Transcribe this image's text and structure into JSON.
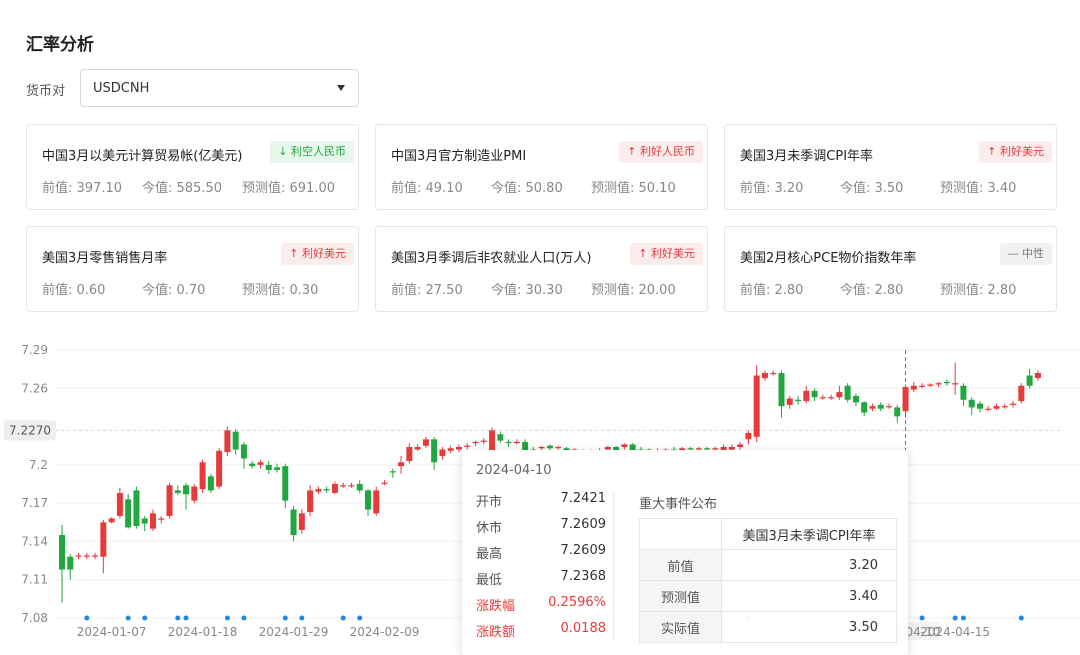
{
  "page": {
    "title": "汇率分析"
  },
  "pair": {
    "label": "货币对",
    "value": "USDCNH"
  },
  "cards": [
    {
      "name": "中国3月以美元计算贸易帐(亿美元)",
      "badge": "利空人民币",
      "badge_icon": "arrow-down-icon",
      "tone": "green",
      "prev": "前值: 397.10",
      "actual": "今值: 585.50",
      "forecast": "预测值: 691.00"
    },
    {
      "name": "中国3月官方制造业PMI",
      "badge": "利好人民币",
      "badge_icon": "arrow-up-icon",
      "tone": "red",
      "prev": "前值: 49.10",
      "actual": "今值: 50.80",
      "forecast": "预测值: 50.10"
    },
    {
      "name": "美国3月未季调CPI年率",
      "badge": "利好美元",
      "badge_icon": "arrow-up-icon",
      "tone": "red",
      "prev": "前值: 3.20",
      "actual": "今值: 3.50",
      "forecast": "预测值: 3.40"
    },
    {
      "name": "美国3月零售销售月率",
      "badge": "利好美元",
      "badge_icon": "arrow-up-icon",
      "tone": "red",
      "prev": "前值: 0.60",
      "actual": "今值: 0.70",
      "forecast": "预测值: 0.30"
    },
    {
      "name": "美国3月季调后非农就业人口(万人)",
      "badge": "利好美元",
      "badge_icon": "arrow-up-icon",
      "tone": "red",
      "prev": "前值: 27.50",
      "actual": "今值: 30.30",
      "forecast": "预测值: 20.00"
    },
    {
      "name": "美国2月核心PCE物价指数年率",
      "badge": "中性",
      "badge_icon": "dash-icon",
      "tone": "gray",
      "prev": "前值: 2.80",
      "actual": "今值: 2.80",
      "forecast": "预测值: 2.80"
    }
  ],
  "colors": {
    "up": "#e63b3b",
    "down": "#22a63f",
    "event_dot": "#1e88e5",
    "crosshair": "#1e88e5",
    "neutral": "#777777"
  },
  "chart_data": {
    "type": "candlestick",
    "y_ticks": [
      "7.29",
      "7.26",
      "7.2",
      "7.17",
      "7.14",
      "7.11",
      "7.08"
    ],
    "ylim": [
      7.08,
      7.29
    ],
    "reference_value": 7.227,
    "reference_label": "7.2270",
    "x_tick_labels": [
      "2024-01-07",
      "2024-01-18",
      "2024-01-29",
      "2024-02-09",
      "2024-04-10",
      "2024-04-15"
    ],
    "x_tick_index": [
      6,
      17,
      28,
      39,
      102,
      108
    ],
    "highlight_index": 102,
    "event_indices": [
      3,
      8,
      10,
      14,
      15,
      20,
      22,
      27,
      29,
      34,
      36,
      83,
      102,
      104,
      108,
      109,
      116
    ],
    "candles": [
      [
        7.145,
        7.118,
        7.153,
        7.092
      ],
      [
        7.128,
        7.118,
        7.13,
        7.11
      ],
      [
        7.129,
        7.129,
        7.131,
        7.126
      ],
      [
        7.129,
        7.129,
        7.131,
        7.126
      ],
      [
        7.129,
        7.129,
        7.131,
        7.126
      ],
      [
        7.128,
        7.155,
        7.157,
        7.115
      ],
      [
        7.155,
        7.158,
        7.159,
        7.154
      ],
      [
        7.16,
        7.178,
        7.182,
        7.158
      ],
      [
        7.173,
        7.151,
        7.177,
        7.15
      ],
      [
        7.18,
        7.152,
        7.183,
        7.15
      ],
      [
        7.158,
        7.154,
        7.16,
        7.148
      ],
      [
        7.15,
        7.162,
        7.165,
        7.148
      ],
      [
        7.157,
        7.158,
        7.16,
        7.154
      ],
      [
        7.16,
        7.184,
        7.186,
        7.158
      ],
      [
        7.18,
        7.178,
        7.184,
        7.176
      ],
      [
        7.184,
        7.177,
        7.186,
        7.165
      ],
      [
        7.172,
        7.183,
        7.185,
        7.17
      ],
      [
        7.181,
        7.202,
        7.204,
        7.178
      ],
      [
        7.191,
        7.18,
        7.193,
        7.178
      ],
      [
        7.183,
        7.211,
        7.213,
        7.181
      ],
      [
        7.21,
        7.227,
        7.23,
        7.207
      ],
      [
        7.226,
        7.212,
        7.228,
        7.208
      ],
      [
        7.216,
        7.205,
        7.218,
        7.197
      ],
      [
        7.201,
        7.199,
        7.203,
        7.197
      ],
      [
        7.2,
        7.202,
        7.204,
        7.197
      ],
      [
        7.2,
        7.196,
        7.203,
        7.193
      ],
      [
        7.198,
        7.196,
        7.201,
        7.194
      ],
      [
        7.199,
        7.172,
        7.201,
        7.166
      ],
      [
        7.165,
        7.145,
        7.168,
        7.14
      ],
      [
        7.149,
        7.162,
        7.165,
        7.146
      ],
      [
        7.163,
        7.18,
        7.184,
        7.16
      ],
      [
        7.179,
        7.181,
        7.183,
        7.177
      ],
      [
        7.181,
        7.18,
        7.183,
        7.178
      ],
      [
        7.178,
        7.185,
        7.187,
        7.177
      ],
      [
        7.183,
        7.184,
        7.186,
        7.182
      ],
      [
        7.184,
        7.184,
        7.186,
        7.182
      ],
      [
        7.185,
        7.18,
        7.188,
        7.178
      ],
      [
        7.18,
        7.165,
        7.181,
        7.16
      ],
      [
        7.162,
        7.18,
        7.183,
        7.16
      ],
      [
        7.186,
        7.186,
        7.188,
        7.184
      ],
      [
        7.195,
        7.194,
        7.197,
        7.19
      ],
      [
        7.199,
        7.202,
        7.207,
        7.193
      ],
      [
        7.203,
        7.214,
        7.217,
        7.201
      ],
      [
        7.212,
        7.214,
        7.216,
        7.211
      ],
      [
        7.215,
        7.22,
        7.222,
        7.213
      ],
      [
        7.22,
        7.202,
        7.222,
        7.196
      ],
      [
        7.207,
        7.212,
        7.214,
        7.204
      ],
      [
        7.211,
        7.213,
        7.215,
        7.209
      ],
      [
        7.212,
        7.214,
        7.216,
        7.21
      ],
      [
        7.214,
        7.215,
        7.217,
        7.212
      ],
      [
        7.217,
        7.218,
        7.219,
        7.215
      ],
      [
        7.218,
        7.219,
        7.221,
        7.216
      ],
      [
        7.21,
        7.227,
        7.229,
        7.207
      ],
      [
        7.224,
        7.219,
        7.226,
        7.217
      ],
      [
        7.218,
        7.217,
        7.22,
        7.214
      ],
      [
        7.218,
        7.218,
        7.22,
        7.216
      ],
      [
        7.218,
        7.209,
        7.22,
        7.204
      ],
      [
        7.212,
        7.211,
        7.214,
        7.209
      ],
      [
        7.213,
        7.214,
        7.215,
        7.211
      ],
      [
        7.215,
        7.213,
        7.216,
        7.211
      ],
      [
        7.214,
        7.214,
        7.215,
        7.212
      ],
      [
        7.213,
        7.209,
        7.214,
        7.206
      ],
      [
        7.212,
        7.212,
        7.213,
        7.21
      ],
      [
        7.211,
        7.211,
        7.212,
        7.21
      ],
      [
        7.211,
        7.209,
        7.212,
        7.207
      ],
      [
        7.209,
        7.211,
        7.213,
        7.207
      ],
      [
        7.212,
        7.214,
        7.215,
        7.21
      ],
      [
        7.214,
        7.211,
        7.215,
        7.209
      ],
      [
        7.214,
        7.216,
        7.217,
        7.212
      ],
      [
        7.216,
        7.21,
        7.217,
        7.208
      ],
      [
        7.212,
        7.211,
        7.214,
        7.209
      ],
      [
        7.212,
        7.21,
        7.213,
        7.208
      ],
      [
        7.21,
        7.211,
        7.213,
        7.208
      ],
      [
        7.212,
        7.212,
        7.213,
        7.21
      ],
      [
        7.212,
        7.211,
        7.214,
        7.209
      ],
      [
        7.211,
        7.213,
        7.214,
        7.21
      ],
      [
        7.213,
        7.212,
        7.214,
        7.211
      ],
      [
        7.212,
        7.213,
        7.214,
        7.211
      ],
      [
        7.213,
        7.212,
        7.214,
        7.211
      ],
      [
        7.212,
        7.213,
        7.214,
        7.211
      ],
      [
        7.21,
        7.214,
        7.216,
        7.208
      ],
      [
        7.212,
        7.214,
        7.216,
        7.21
      ],
      [
        7.214,
        7.216,
        7.218,
        7.212
      ],
      [
        7.22,
        7.225,
        7.227,
        7.216
      ],
      [
        7.222,
        7.27,
        7.278,
        7.218
      ],
      [
        7.268,
        7.272,
        7.274,
        7.266
      ],
      [
        7.272,
        7.272,
        7.274,
        7.27
      ],
      [
        7.272,
        7.246,
        7.274,
        7.237
      ],
      [
        7.247,
        7.252,
        7.254,
        7.244
      ],
      [
        7.251,
        7.25,
        7.254,
        7.247
      ],
      [
        7.25,
        7.258,
        7.262,
        7.248
      ],
      [
        7.258,
        7.253,
        7.26,
        7.25
      ],
      [
        7.253,
        7.253,
        7.255,
        7.251
      ],
      [
        7.253,
        7.253,
        7.255,
        7.251
      ],
      [
        7.253,
        7.257,
        7.262,
        7.251
      ],
      [
        7.262,
        7.251,
        7.264,
        7.249
      ],
      [
        7.254,
        7.249,
        7.256,
        7.246
      ],
      [
        7.249,
        7.241,
        7.25,
        7.238
      ],
      [
        7.244,
        7.246,
        7.248,
        7.242
      ],
      [
        7.247,
        7.244,
        7.249,
        7.242
      ],
      [
        7.246,
        7.246,
        7.248,
        7.244
      ],
      [
        7.245,
        7.238,
        7.247,
        7.233
      ],
      [
        7.242,
        7.261,
        7.263,
        7.237
      ],
      [
        7.259,
        7.262,
        7.265,
        7.257
      ],
      [
        7.262,
        7.262,
        7.264,
        7.26
      ],
      [
        7.262,
        7.263,
        7.264,
        7.261
      ],
      [
        7.263,
        7.264,
        7.265,
        7.261
      ],
      [
        7.265,
        7.264,
        7.267,
        7.262
      ],
      [
        7.263,
        7.264,
        7.28,
        7.255
      ],
      [
        7.262,
        7.251,
        7.264,
        7.246
      ],
      [
        7.251,
        7.245,
        7.253,
        7.239
      ],
      [
        7.248,
        7.244,
        7.25,
        7.241
      ],
      [
        7.244,
        7.244,
        7.246,
        7.242
      ],
      [
        7.244,
        7.246,
        7.248,
        7.243
      ],
      [
        7.246,
        7.246,
        7.248,
        7.244
      ],
      [
        7.247,
        7.248,
        7.25,
        7.245
      ],
      [
        7.25,
        7.262,
        7.264,
        7.248
      ],
      [
        7.27,
        7.262,
        7.275,
        7.26
      ],
      [
        7.268,
        7.272,
        7.274,
        7.266
      ]
    ]
  },
  "tooltip": {
    "date": "2024-04-10",
    "rows": [
      {
        "label": "开市",
        "value": "7.2421",
        "tone": "normal"
      },
      {
        "label": "休市",
        "value": "7.2609",
        "tone": "normal"
      },
      {
        "label": "最高",
        "value": "7.2609",
        "tone": "normal"
      },
      {
        "label": "最低",
        "value": "7.2368",
        "tone": "normal"
      },
      {
        "label": "涨跌幅",
        "value": "0.2596%",
        "tone": "up"
      },
      {
        "label": "涨跌额",
        "value": "0.0188",
        "tone": "up"
      }
    ],
    "event_title": "重大事件公布",
    "event": {
      "name": "美国3月未季调CPI年率",
      "rows": [
        {
          "label": "前值",
          "value": "3.20"
        },
        {
          "label": "预测值",
          "value": "3.40"
        },
        {
          "label": "实际值",
          "value": "3.50"
        }
      ]
    }
  }
}
